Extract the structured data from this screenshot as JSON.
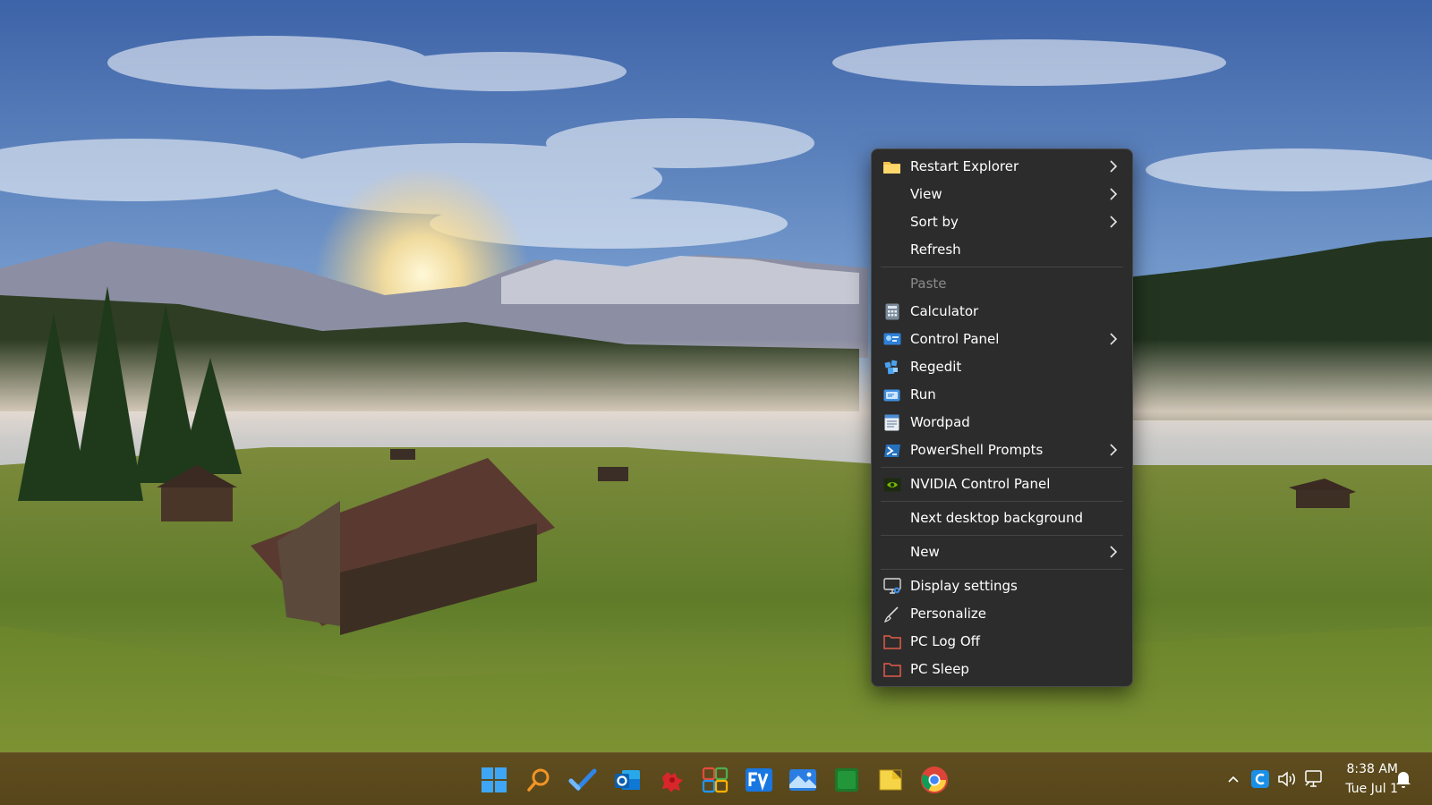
{
  "context_menu": {
    "items": [
      {
        "label": "Restart Explorer",
        "icon": "folder-icon",
        "submenu": true
      },
      {
        "label": "View",
        "icon": null,
        "submenu": true
      },
      {
        "label": "Sort by",
        "icon": null,
        "submenu": true
      },
      {
        "label": "Refresh",
        "icon": null,
        "submenu": false
      },
      {
        "label": "Paste",
        "icon": null,
        "submenu": false,
        "disabled": true
      },
      {
        "label": "Calculator",
        "icon": "calculator-icon",
        "submenu": false
      },
      {
        "label": "Control Panel",
        "icon": "control-panel-icon",
        "submenu": true
      },
      {
        "label": "Regedit",
        "icon": "regedit-icon",
        "submenu": false
      },
      {
        "label": "Run",
        "icon": "run-icon",
        "submenu": false
      },
      {
        "label": "Wordpad",
        "icon": "wordpad-icon",
        "submenu": false
      },
      {
        "label": "PowerShell Prompts",
        "icon": "powershell-icon",
        "submenu": true
      },
      {
        "label": "NVIDIA Control Panel",
        "icon": "nvidia-icon",
        "submenu": false
      },
      {
        "label": "Next desktop background",
        "icon": null,
        "submenu": false
      },
      {
        "label": "New",
        "icon": null,
        "submenu": true
      },
      {
        "label": "Display settings",
        "icon": "display-settings-icon",
        "submenu": false
      },
      {
        "label": "Personalize",
        "icon": "personalize-icon",
        "submenu": false
      },
      {
        "label": "PC Log Off",
        "icon": "folder-outline-icon",
        "submenu": false
      },
      {
        "label": "PC Sleep",
        "icon": "folder-outline-icon",
        "submenu": false
      }
    ]
  },
  "taskbar": {
    "apps": [
      {
        "name": "start-button",
        "icon": "windows-logo-icon"
      },
      {
        "name": "search-button",
        "icon": "search-icon"
      },
      {
        "name": "taskbar-app-todo",
        "icon": "checkmark-icon"
      },
      {
        "name": "taskbar-app-outlook",
        "icon": "outlook-icon"
      },
      {
        "name": "taskbar-app-red-app",
        "icon": "red-puzzle-icon"
      },
      {
        "name": "taskbar-app-grid",
        "icon": "app-grid-icon"
      },
      {
        "name": "taskbar-app-fv",
        "icon": "fv-icon"
      },
      {
        "name": "taskbar-app-photos",
        "icon": "photos-icon"
      },
      {
        "name": "taskbar-app-green",
        "icon": "green-app-icon"
      },
      {
        "name": "taskbar-app-file-explorer",
        "icon": "file-explorer-icon"
      },
      {
        "name": "taskbar-app-chrome",
        "icon": "chrome-icon"
      }
    ],
    "tray": {
      "icons": [
        "chevron-up-icon",
        "c-app-icon",
        "volume-icon",
        "network-icon",
        "notification-bell-icon"
      ],
      "time": "8:38 AM",
      "date": "Tue Jul 1"
    }
  },
  "colors": {
    "menu_bg": "#2c2c2c",
    "menu_text": "#ffffff",
    "menu_disabled_text": "#8a8a8a",
    "taskbar_bg": "#5b4a1e"
  }
}
